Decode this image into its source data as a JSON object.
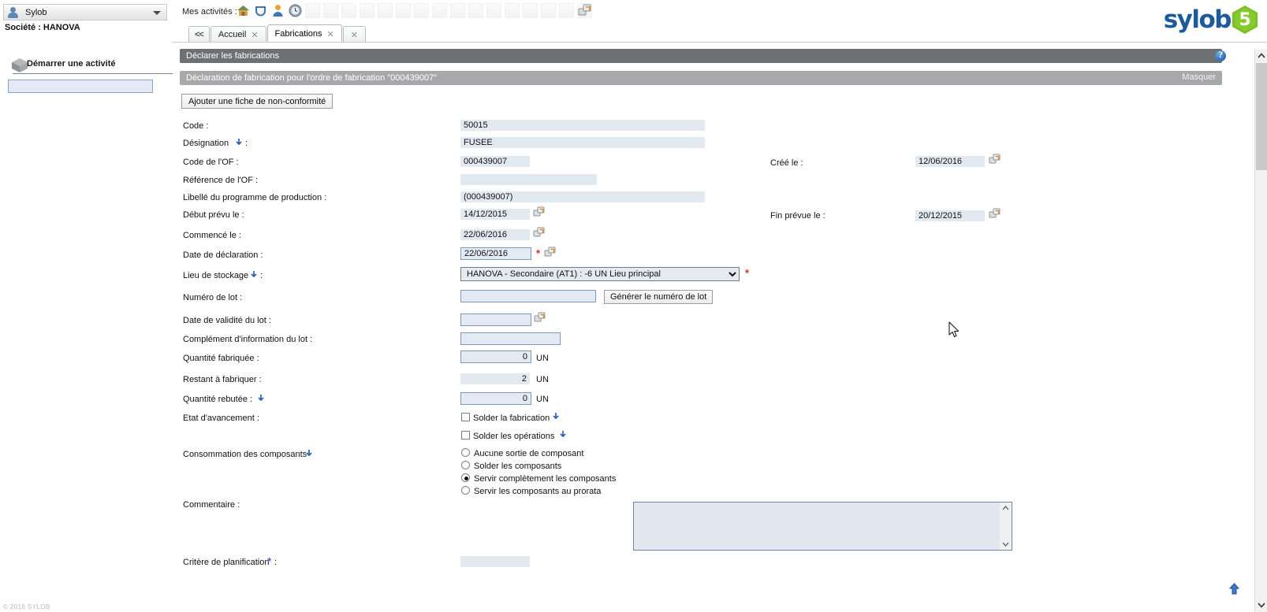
{
  "sidebar": {
    "user_name": "Sylob",
    "avatar_icon": "user-avatar-icon",
    "caret_icon": "chevron-down-icon",
    "company_label": "Société : HANOVA",
    "activity_title": "Démarrer une activité",
    "activity_icon": "cube-icon",
    "activity_input_value": "",
    "activity_input_placeholder": "",
    "footer_text": "© 2016 SYLOB"
  },
  "topbar": {
    "activities_label": "Mes activités :",
    "icons": [
      "home-icon",
      "shield-icon",
      "person-icon",
      "clock-icon"
    ],
    "empty_slot_count": 16,
    "right_icon": "link-new-window-icon"
  },
  "tabs": {
    "prev_label": "<<",
    "items": [
      {
        "label": "Accueil",
        "active": false,
        "close_icon": "close-icon"
      },
      {
        "label": "Fabrications",
        "active": true,
        "close_icon": "close-icon"
      }
    ],
    "extra_close_icon": "close-icon"
  },
  "logo": {
    "text": "sylob",
    "badge": "5",
    "text_color": "#1d5a9c",
    "badge_color": "#7cc124"
  },
  "panel": {
    "title": "Déclarer les fabrications",
    "help_icon": "help-icon",
    "help_glyph": "?",
    "subtitle": "Déclaration de fabrication pour l'ordre de fabrication \"000439007\"",
    "hide_label": "Masquer",
    "nonconformity_button": "Ajouter une fiche de non-conformité"
  },
  "form": {
    "code": {
      "label": "Code :",
      "value": "50015"
    },
    "designation": {
      "label": "Désignation",
      "suffix": ":",
      "value": "FUSEE",
      "info_icon": "info-arrow-icon"
    },
    "of_code": {
      "label": "Code de l'OF :",
      "value": "000439007"
    },
    "of_reference": {
      "label": "Référence de l'OF :",
      "value": ""
    },
    "program_label": {
      "label": "Libellé du programme de production :",
      "value": "(000439007)"
    },
    "planned_start": {
      "label": "Début prévu le :",
      "value": "14/12/2015",
      "calendar_icon": "calendar-picker-icon"
    },
    "started_on": {
      "label": "Commencé le  :",
      "value": "22/06/2016",
      "calendar_icon": "calendar-picker-icon"
    },
    "declaration_date": {
      "label": "Date de déclaration :",
      "value": "22/06/2016",
      "required": "*",
      "calendar_icon": "calendar-picker-icon"
    },
    "storage_location": {
      "label": "Lieu de stockage",
      "suffix": ":",
      "info_icon": "info-arrow-icon",
      "selected": "HANOVA - Secondaire (AT1) : -6 UN          Lieu principal",
      "options": [
        "HANOVA - Secondaire (AT1) : -6 UN          Lieu principal"
      ],
      "required": "*",
      "dropdown_icon": "chevron-down-icon"
    },
    "lot_number": {
      "label": "Numéro de lot :",
      "value": "",
      "button": "Générer le numéro de lot"
    },
    "lot_validity": {
      "label": "Date de validité du lot :",
      "value": "",
      "calendar_icon": "calendar-picker-icon"
    },
    "lot_info": {
      "label": "Complément d'information du lot :",
      "value": ""
    },
    "qty_made": {
      "label": "Quantité fabriquée :",
      "value": "0",
      "unit": "UN"
    },
    "qty_remaining": {
      "label": "Restant à fabriquer :",
      "value": "2",
      "unit": "UN"
    },
    "qty_scrapped": {
      "label": "Quantité rebutée :",
      "value": "0",
      "unit": "UN",
      "info_icon": "info-arrow-icon"
    },
    "progress": {
      "label": "Etat d'avancement  :",
      "checkboxes": [
        {
          "label": "Solder la fabrication",
          "checked": false,
          "info_icon": "info-arrow-icon"
        },
        {
          "label": "Solder les opérations",
          "checked": false,
          "info_icon": "info-arrow-icon"
        }
      ]
    },
    "consumption": {
      "label": "Consommation des composants",
      "info_icon": "info-arrow-icon",
      "options": [
        {
          "label": "Aucune sortie de composant",
          "selected": false
        },
        {
          "label": "Solder les composants",
          "selected": false
        },
        {
          "label": "Servir complètement les composants",
          "selected": true
        },
        {
          "label": "Servir les composants au prorata",
          "selected": false
        }
      ]
    },
    "comment": {
      "label": "Commentaire :",
      "value": "",
      "scroll_up_icon": "chevron-up-icon",
      "scroll_down_icon": "chevron-down-icon"
    },
    "planning_criteria": {
      "label": "Critère de planification",
      "suffix": ":",
      "required": "*",
      "value": ""
    },
    "created_on": {
      "label": "Créé le :",
      "value": "12/06/2016",
      "calendar_icon": "calendar-picker-icon"
    },
    "planned_end": {
      "label": "Fin prévue le :",
      "value": "20/12/2015",
      "calendar_icon": "calendar-picker-icon"
    }
  },
  "scrollbar": {
    "up_icon": "chevron-up-icon",
    "down_icon": "chevron-down-icon"
  },
  "bottom_arrow_icon": "scroll-to-top-icon",
  "cursor_icon": "mouse-pointer-icon"
}
